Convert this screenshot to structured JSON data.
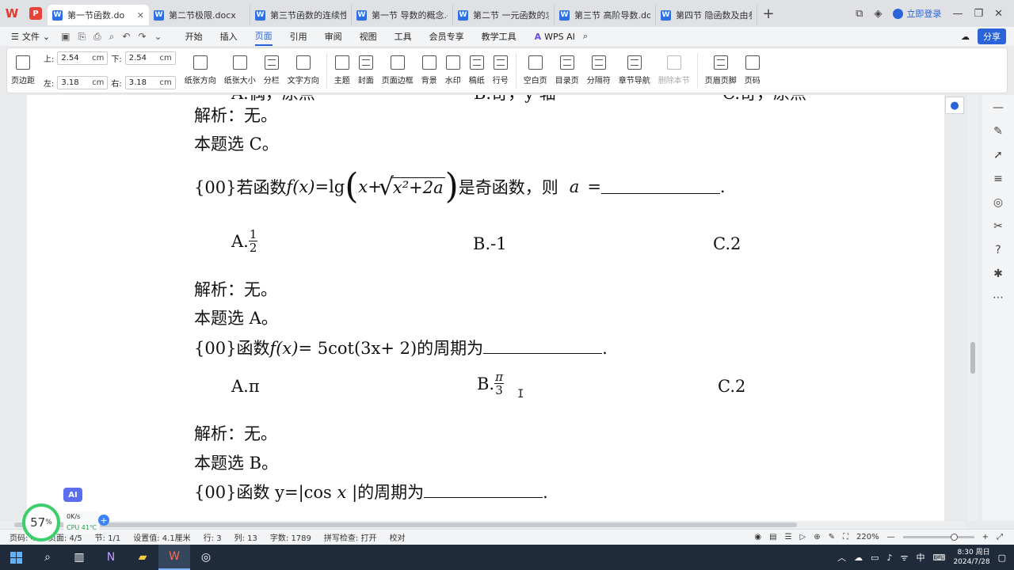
{
  "tabs": [
    {
      "label": "第一节函数.do",
      "active": true
    },
    {
      "label": "第二节极限.docx",
      "active": false
    },
    {
      "label": "第三节函数的连续性.c",
      "active": false
    },
    {
      "label": "第一节 导数的概念.dc",
      "active": false
    },
    {
      "label": "第二节 一元函数的求",
      "active": false
    },
    {
      "label": "第三节 高阶导数.docx",
      "active": false
    },
    {
      "label": "第四节 隐函数及由参",
      "active": false
    }
  ],
  "header": {
    "login_label": "立即登录",
    "share_label": "分享"
  },
  "menu": {
    "file_label": "文件",
    "items": [
      "开始",
      "插入",
      "页面",
      "引用",
      "审阅",
      "视图",
      "工具",
      "会员专享",
      "教学工具"
    ],
    "active": "页面",
    "wps_ai_label": "WPS AI"
  },
  "ribbon": {
    "margins_label": "页边距",
    "top_label": "上:",
    "top_value": "2.54",
    "bottom_label": "下:",
    "bottom_value": "2.54",
    "left_label": "左:",
    "left_value": "3.18",
    "right_label": "右:",
    "right_value": "3.18",
    "unit": "cm",
    "buttons": [
      {
        "label": "纸张方向",
        "icon": "page-orientation-icon"
      },
      {
        "label": "纸张大小",
        "icon": "paper-size-icon"
      },
      {
        "label": "分栏",
        "icon": "columns-icon"
      },
      {
        "label": "文字方向",
        "icon": "text-direction-icon"
      }
    ],
    "buttons2": [
      {
        "label": "主题",
        "icon": "theme-icon"
      },
      {
        "label": "封面",
        "icon": "cover-icon"
      },
      {
        "label": "页面边框",
        "icon": "page-border-icon"
      },
      {
        "label": "背景",
        "icon": "background-icon"
      },
      {
        "label": "水印",
        "icon": "watermark-icon"
      },
      {
        "label": "稿纸",
        "icon": "manuscript-icon"
      },
      {
        "label": "行号",
        "icon": "line-number-icon"
      }
    ],
    "buttons3": [
      {
        "label": "空白页",
        "icon": "blank-page-icon"
      },
      {
        "label": "目录页",
        "icon": "toc-page-icon"
      },
      {
        "label": "分隔符",
        "icon": "separator-icon"
      },
      {
        "label": "章节导航",
        "icon": "chapter-nav-icon"
      },
      {
        "label": "删除本节",
        "icon": "delete-section-icon"
      }
    ],
    "buttons4": [
      {
        "label": "页眉页脚",
        "icon": "header-footer-icon"
      },
      {
        "label": "页码",
        "icon": "page-number-icon"
      }
    ]
  },
  "document": {
    "top_cut": {
      "a": "A.偶，原点",
      "b": "B.奇，y 轴",
      "c": "C.奇，原点"
    },
    "analysis_1": "解析：无。",
    "answer_1": "本题选 C。",
    "q2": {
      "prefix": "{00}若函数",
      "fx": "f(x)",
      "eq": "=lg",
      "x": "x",
      "plus": "+",
      "radicand": "x²+2a",
      "suffix": "是奇函数，则",
      "var": "a",
      "eq2": "=",
      "end": "."
    },
    "q2_options": {
      "a_prefix": "A.",
      "a_num": "1",
      "a_den": "2",
      "b": "B.-1",
      "c": "C.2"
    },
    "analysis_2": "解析：无。",
    "answer_2": "本题选 A。",
    "q3": {
      "prefix": "{00}函数",
      "fx": "f(x)",
      "body": "= 5cot(3x+ 2)的周期为",
      "end": "."
    },
    "q3_options": {
      "a": "A.π",
      "b_prefix": "B.",
      "b_num": "π",
      "b_den": "3",
      "c": "C.2"
    },
    "analysis_3": "解析：无。",
    "answer_3": "本题选 B。",
    "q4": {
      "prefix": "{00}函数 y=|cos",
      "x": "x",
      "body": "|的周期为",
      "end": "."
    }
  },
  "status": {
    "page": "页码: 4",
    "pages": "页面: 4/5",
    "section": "节: 1/1",
    "setting": "设置值: 4.1厘米",
    "row": "行: 3",
    "col": "列: 13",
    "words": "字数: 1789",
    "spell": "拼写检查: 打开",
    "proof": "校对",
    "zoom": "220%"
  },
  "taskbar": {
    "time": "8:30 周日",
    "date": "2024/7/28",
    "ime": "中"
  },
  "widgets": {
    "ai_badge": "AI",
    "perf_percent": "57",
    "perf_unit": "%",
    "net_speed": "0K/s",
    "cpu_label": "CPU 41℃"
  }
}
